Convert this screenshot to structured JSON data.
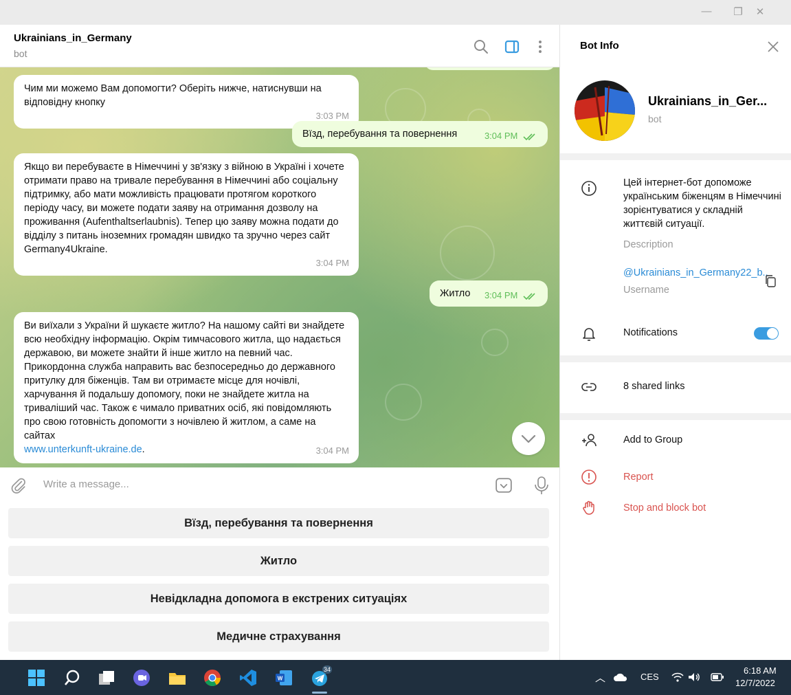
{
  "chat": {
    "title": "Ukrainians_in_Germany",
    "subtitle": "bot"
  },
  "messages": [
    {
      "text": "Чим ми можемо Вам допомогти? Оберіть нижче, натиснувши на відповідну кнопку",
      "time": "3:03 PM",
      "direction": "in"
    },
    {
      "text": "Вїзд, перебування та повернення",
      "time": "3:04 PM",
      "direction": "out"
    },
    {
      "text": "Якщо ви перебуваєте в Німеччині у зв'язку з війною в Україні і хочете отримати право на тривале перебування в Німеччині або соціальну підтримку, або мати можливість працювати протягом короткого періоду часу, ви можете подати заяву на отримання дозволу на проживання (Aufenthaltserlaubnis). Тепер цю заяву можна подати до відділу з питань іноземних громадян швидко та зручно через сайт Germany4Ukraine.",
      "time": "3:04 PM",
      "direction": "in"
    },
    {
      "text": "Житло",
      "time": "3:04 PM",
      "direction": "out"
    },
    {
      "text": "Ви виїхали з України й шукаєте житло? На нашому сайті ви знайдете всю необхідну інформацію. Окрім тимчасового житла, що надається державою, ви можете знайти й інше житло на певний час. Прикордонна служба направить вас безпосередньо до державного притулку для біженців. Там ви отримаєте місце для ночівлі, харчування й подальшу допомогу, поки не знайдете житла на триваліший час. Також є чимало приватних осіб, які повідомляють про свою готовність допомогти з ночівлею й житлом, а саме на сайтах",
      "link": "www.unterkunft-ukraine.de",
      "after_link": ".",
      "time": "3:04 PM",
      "direction": "in"
    }
  ],
  "composer": {
    "placeholder": "Write a message..."
  },
  "keyboard": [
    "Вїзд, перебування та повернення",
    "Житло",
    "Невідкладна допомога в екстрених ситуаціях",
    "Медичне страхування"
  ],
  "bot_info": {
    "panel_title": "Bot Info",
    "name": "Ukrainians_in_Ger...",
    "subtitle": "bot",
    "description": "Цей інтернет-бот допоможе українським біженцям в Німеччині зорієнтуватися у складній життєвій ситуації.",
    "description_label": "Description",
    "username": "@Ukrainians_in_Germany22_b...",
    "username_label": "Username",
    "notifications_label": "Notifications",
    "notifications_on": true,
    "shared_links": "8 shared links",
    "add_to_group": "Add to Group",
    "report": "Report",
    "stop_block": "Stop and block bot"
  },
  "colors": {
    "accent": "#3a9ce0",
    "danger": "#d9534f",
    "outgoing_bubble": "#effdde",
    "check_green": "#5fbe58"
  },
  "taskbar": {
    "language": "CES",
    "time": "6:18 AM",
    "date": "12/7/2022",
    "telegram_badge": "34",
    "icons": [
      "windows-start-icon",
      "search-icon",
      "task-view-icon",
      "chat-icon",
      "file-explorer-icon",
      "chrome-icon",
      "vscode-icon",
      "word-icon",
      "telegram-icon"
    ]
  }
}
